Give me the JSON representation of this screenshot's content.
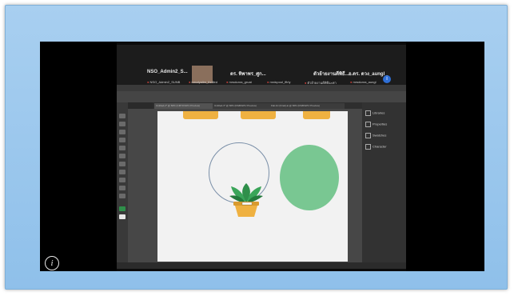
{
  "zoom_meeting": {
    "participant_left": "NSO_Admin2_S...",
    "participant_mid": "ดร. ทิพาพร_ศูก...",
    "participant_right1": "ตัวย้ายงานดีพิธี...",
    "participant_right2": "อ.ดร. ดวง_aungl",
    "sub_labels": [
      "NSO_Admin2_SUNB",
      "mrudyalim_thrilled",
      "mrsdunra_gruat",
      "mrdcpool_ffirly",
      "ตัวย้ายงานดีพิธีนะค่า",
      "mrsdunra_aungl"
    ],
    "info_button": "i"
  },
  "illustrator": {
    "tabs": [
      "Untitled-2* @ 66% (CMYK/GPU Preview)",
      "Untitled-3* @ 66% (RGB/GPU Preview)",
      "Flat Art (Final).ai @ 66% (RGB/GPU Preview)"
    ],
    "panels": [
      "Libraries",
      "Properties",
      "Swatches",
      "Character"
    ],
    "colors": {
      "pot": "#efb141",
      "leaf": "#2f8f4a",
      "circle": "#79c792"
    }
  },
  "overlay": {
    "info_icon": "i"
  }
}
